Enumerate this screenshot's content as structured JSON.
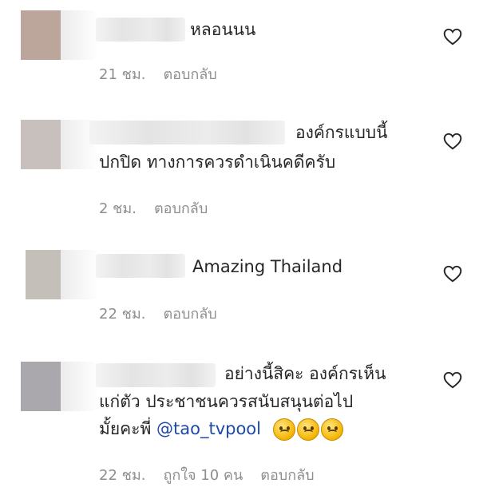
{
  "comments": [
    {
      "text": "หลอนนน",
      "time": "21 ชม.",
      "reply": "ตอบกลับ"
    },
    {
      "text_line1": "องค์กรแบบนี้",
      "text_line2": "ปกปิด ทางการควรดำเนินคดีครับ",
      "time": "2 ชม.",
      "reply": "ตอบกลับ"
    },
    {
      "text": "Amazing Thailand",
      "time": "22 ชม.",
      "reply": "ตอบกลับ"
    },
    {
      "text_line1": "อย่างนี้สิคะ องค์กรเห็น",
      "text_line2": "แก่ตัว ประชาชนควรสนับสนุนต่อไป",
      "text_line3_prefix": "มั้ยคะพี่",
      "mention": "@tao_tvpool",
      "emoji_count": 3,
      "emoji_name": "crying-face-emoji",
      "time": "22 ชม.",
      "likes": "ถูกใจ 10 คน",
      "reply": "ตอบกลับ"
    }
  ],
  "colors": {
    "text": "#262626",
    "meta": "#8e8e8e",
    "mention": "#1f4aa8"
  },
  "icons": {
    "like": "heart-outline-icon"
  }
}
